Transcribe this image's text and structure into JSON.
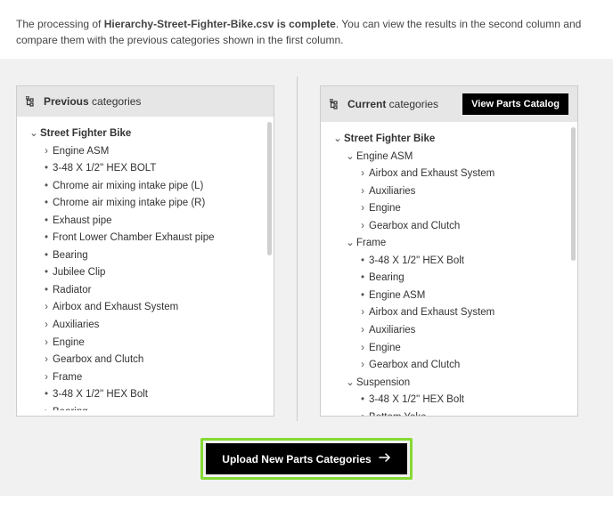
{
  "notice": {
    "before": "The processing of ",
    "filename": "Hierarchy-Street-Fighter-Bike.csv is complete",
    "after": ". You can view the results in the second column and compare them with the previous categories shown in the first column."
  },
  "panels": {
    "previous": {
      "title_bold": "Previous",
      "title_rest": " categories"
    },
    "current": {
      "title_bold": "Current",
      "title_rest": " categories",
      "button": "View Parts Catalog"
    }
  },
  "tree_previous": [
    {
      "level": 0,
      "bullet": "down",
      "bold": true,
      "label": "Street Fighter Bike"
    },
    {
      "level": 1,
      "bullet": "right",
      "label": "Engine ASM"
    },
    {
      "level": 1,
      "bullet": "dot",
      "label": "3-48 X 1/2\" HEX BOLT"
    },
    {
      "level": 1,
      "bullet": "dot",
      "label": "Chrome air mixing intake pipe (L)"
    },
    {
      "level": 1,
      "bullet": "dot",
      "label": "Chrome air mixing intake pipe (R)"
    },
    {
      "level": 1,
      "bullet": "dot",
      "label": "Exhaust pipe"
    },
    {
      "level": 1,
      "bullet": "dot",
      "label": "Front Lower Chamber Exhaust pipe"
    },
    {
      "level": 1,
      "bullet": "dot",
      "label": "Bearing"
    },
    {
      "level": 1,
      "bullet": "dot",
      "label": "Jubilee Clip"
    },
    {
      "level": 1,
      "bullet": "dot",
      "label": "Radiator"
    },
    {
      "level": 1,
      "bullet": "right",
      "label": "Airbox and Exhaust System"
    },
    {
      "level": 1,
      "bullet": "right",
      "label": "Auxiliaries"
    },
    {
      "level": 1,
      "bullet": "right",
      "label": "Engine"
    },
    {
      "level": 1,
      "bullet": "right",
      "label": "Gearbox and Clutch"
    },
    {
      "level": 1,
      "bullet": "right",
      "label": "Frame"
    },
    {
      "level": 1,
      "bullet": "dot",
      "label": "3-48 X 1/2\" HEX Bolt"
    },
    {
      "level": 1,
      "bullet": "right",
      "label": "Bearing"
    }
  ],
  "tree_current": [
    {
      "level": 0,
      "bullet": "down",
      "bold": true,
      "label": "Street Fighter Bike"
    },
    {
      "level": 1,
      "bullet": "down",
      "label": "Engine ASM"
    },
    {
      "level": 2,
      "bullet": "right",
      "label": "Airbox and Exhaust System"
    },
    {
      "level": 2,
      "bullet": "right",
      "label": "Auxiliaries"
    },
    {
      "level": 2,
      "bullet": "right",
      "label": "Engine"
    },
    {
      "level": 2,
      "bullet": "right",
      "label": "Gearbox and Clutch"
    },
    {
      "level": 1,
      "bullet": "down",
      "label": "Frame"
    },
    {
      "level": 2,
      "bullet": "dot",
      "label": "3-48 X 1/2\" HEX Bolt"
    },
    {
      "level": 2,
      "bullet": "dot",
      "label": "Bearing"
    },
    {
      "level": 2,
      "bullet": "dot",
      "label": "Engine ASM"
    },
    {
      "level": 2,
      "bullet": "right",
      "label": "Airbox and Exhaust System"
    },
    {
      "level": 2,
      "bullet": "right",
      "label": "Auxiliaries"
    },
    {
      "level": 2,
      "bullet": "right",
      "label": "Engine"
    },
    {
      "level": 2,
      "bullet": "right",
      "label": "Gearbox and Clutch"
    },
    {
      "level": 1,
      "bullet": "down",
      "label": "Suspension"
    },
    {
      "level": 2,
      "bullet": "dot",
      "label": "3-48 X 1/2\" HEX Bolt"
    },
    {
      "level": 2,
      "bullet": "dot",
      "label": "Bottom Yoke"
    }
  ],
  "footer": {
    "upload_label": "Upload New Parts Categories"
  }
}
